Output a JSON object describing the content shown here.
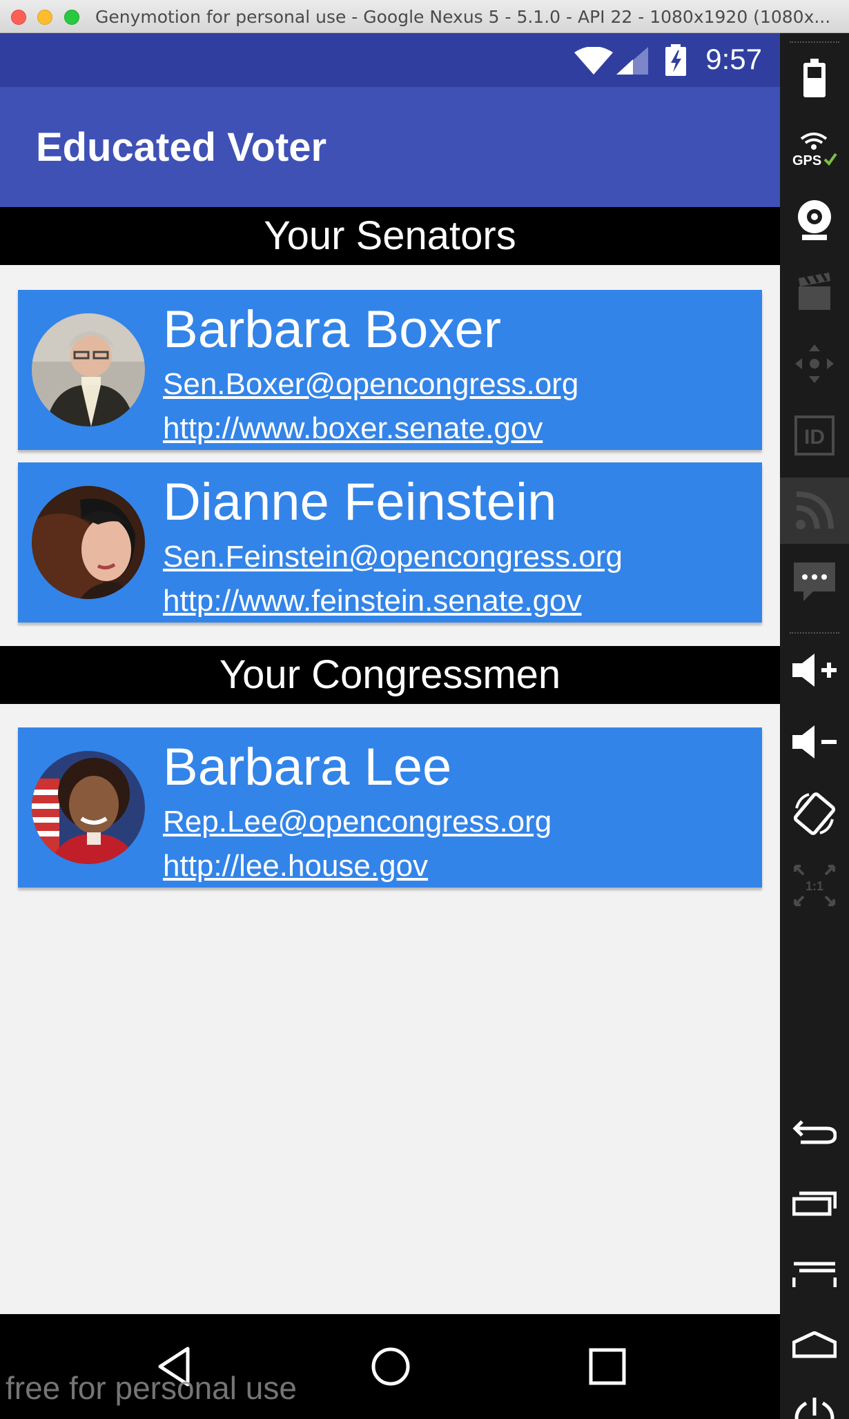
{
  "window": {
    "title": "Genymotion for personal use - Google Nexus 5 - 5.1.0 - API 22 - 1080x1920 (1080x..."
  },
  "status_bar": {
    "time": "9:57"
  },
  "app": {
    "title": "Educated Voter"
  },
  "sections": {
    "senators_title": "Your Senators",
    "congressmen_title": "Your Congressmen"
  },
  "senators": [
    {
      "name": "Barbara Boxer",
      "email": "Sen.Boxer@opencongress.org",
      "website": "http://www.boxer.senate.gov"
    },
    {
      "name": "Dianne Feinstein",
      "email": "Sen.Feinstein@opencongress.org",
      "website": "http://www.feinstein.senate.gov"
    }
  ],
  "congressmen": [
    {
      "name": "Barbara Lee",
      "email": "Rep.Lee@opencongress.org",
      "website": "http://lee.house.gov"
    }
  ],
  "watermark": "free for personal use",
  "sidebar": {
    "gps_label": "GPS",
    "id_label": "ID",
    "scale_label": "1:1"
  },
  "colors": {
    "status_bar": "#303f9f",
    "app_bar": "#3f51b5",
    "card": "#3384e8",
    "section_header": "#000000"
  }
}
